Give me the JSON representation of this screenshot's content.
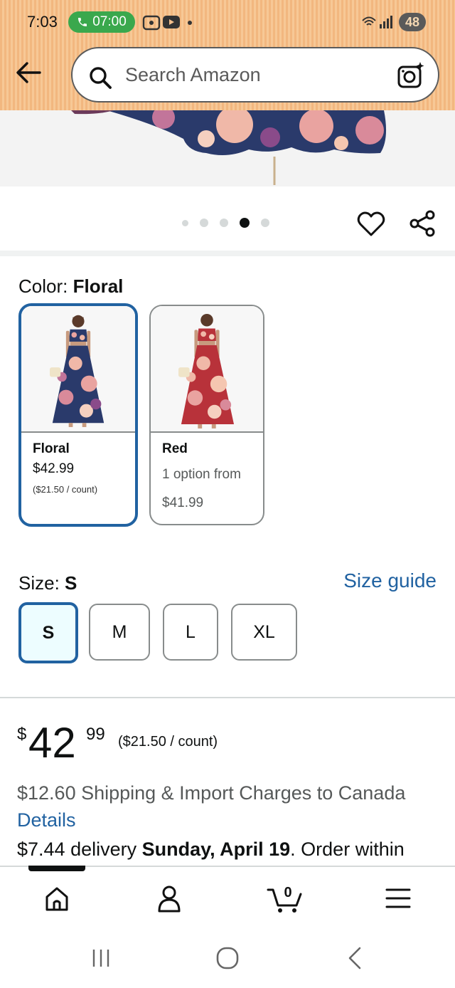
{
  "status_bar": {
    "time": "7:03",
    "call_timer": "07:00",
    "battery": "48"
  },
  "search": {
    "placeholder": "Search Amazon"
  },
  "carousel": {
    "total": 5,
    "active_index": 3
  },
  "color": {
    "label": "Color:",
    "selected": "Floral",
    "options": [
      {
        "name": "Floral",
        "price": "$42.99",
        "unit_price": "($21.50 / count)"
      },
      {
        "name": "Red",
        "availability": "1 option from",
        "price": "$41.99"
      }
    ]
  },
  "size": {
    "label": "Size:",
    "selected": "S",
    "guide_link": "Size guide",
    "options": [
      "S",
      "M",
      "L",
      "XL"
    ]
  },
  "price": {
    "symbol": "$",
    "whole": "42",
    "fraction": "99",
    "unit_price": "($21.50 / count)"
  },
  "shipping": {
    "text": "$12.60 Shipping & Import Charges to Canada",
    "details_link": "Details",
    "delivery_cost": "$7.44 delivery ",
    "delivery_date": "Sunday, April 19",
    "delivery_tail": ". Order within"
  },
  "bottom_nav": {
    "cart_count": "0",
    "items": [
      "home-icon",
      "account-icon",
      "cart-icon",
      "menu-icon"
    ]
  },
  "colors": {
    "accent": "#2162a1",
    "header_bg": "#f5bf8a",
    "call_green": "#3aa84d"
  }
}
